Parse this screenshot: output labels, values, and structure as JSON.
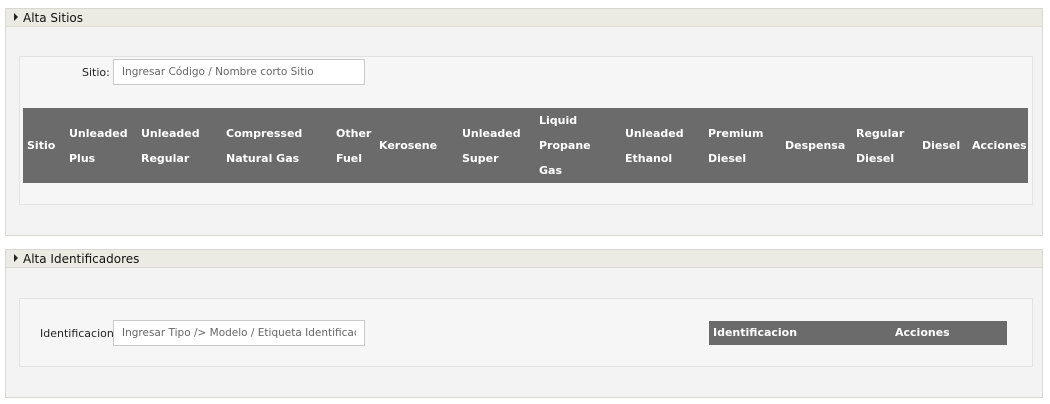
{
  "alta_sitios": {
    "title": "Alta Sitios",
    "sitio_label": "Sitio:",
    "sitio_placeholder": "Ingresar Código / Nombre corto Sitio",
    "columns": [
      "Sitio",
      "Unleaded\nPlus",
      "Unleaded\nRegular",
      "Compressed\nNatural Gas",
      "Other\nFuel",
      "Kerosene",
      "Unleaded\nSuper",
      "Liquid\nPropane\nGas",
      "Unleaded\nEthanol",
      "Premium\nDiesel",
      "Despensa",
      "Regular\nDiesel",
      "Diesel",
      "Acciones"
    ]
  },
  "alta_identificadores": {
    "title": "Alta Identificadores",
    "identificacion_label": "Identificacion:",
    "identificacion_placeholder": "Ingresar Tipo /> Modelo / Etiqueta Identificacion",
    "columns": [
      "Identificacion",
      "Acciones"
    ]
  }
}
